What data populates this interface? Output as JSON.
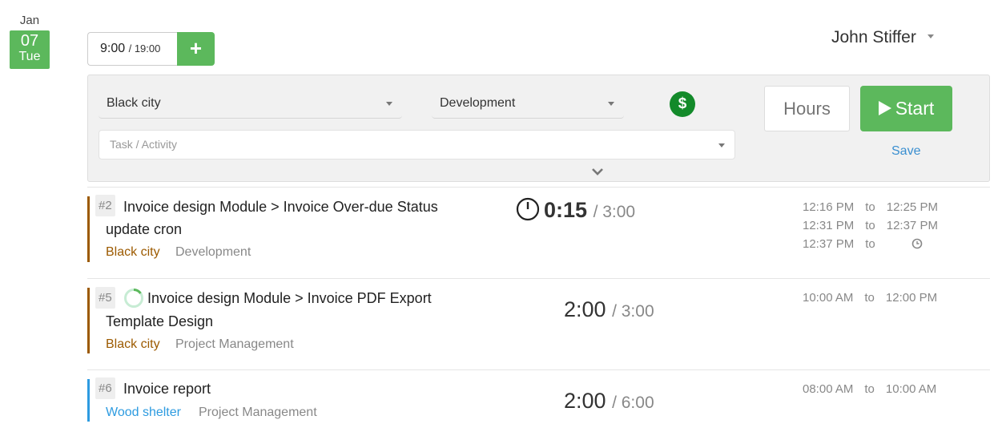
{
  "date": {
    "month": "Jan",
    "day": "07",
    "weekday": "Tue"
  },
  "summary": {
    "worked": "9:00",
    "total": "/ 19:00",
    "add_label": "+"
  },
  "user": {
    "name": "John Stiffer"
  },
  "entry_form": {
    "project": "Black city",
    "category": "Development",
    "billable_symbol": "$",
    "task_placeholder": "Task / Activity",
    "hours_placeholder": "Hours",
    "start_label": "Start",
    "save_label": "Save"
  },
  "colors": {
    "accent_green": "#5cb85c",
    "billable_green": "#138a2a",
    "project_brown": "#9c5a00",
    "project_blue": "#2d9be0",
    "link_blue": "#3a8fd0"
  },
  "entries": [
    {
      "num": "#2",
      "title_line1": "Invoice design Module > Invoice Over-due Status",
      "title_line2": "update cron",
      "project": "Black city",
      "category": "Development",
      "duration": "0:15",
      "estimate": "/ 3:00",
      "running": true,
      "times": [
        {
          "start": "12:16 PM",
          "to": "to",
          "end": "12:25 PM"
        },
        {
          "start": "12:31 PM",
          "to": "to",
          "end": "12:37 PM"
        },
        {
          "start": "12:37 PM",
          "to": "to",
          "end": ""
        }
      ]
    },
    {
      "num": "#5",
      "title_line1": "Invoice design Module > Invoice PDF Export",
      "title_line2": "Template Design",
      "project": "Black city",
      "category": "Project Management",
      "duration": "2:00",
      "estimate": "/ 3:00",
      "times": [
        {
          "start": "10:00 AM",
          "to": "to",
          "end": "12:00 PM"
        }
      ]
    },
    {
      "num": "#6",
      "title_line1": "Invoice report",
      "project": "Wood shelter",
      "category": "Project Management",
      "duration": "2:00",
      "estimate": "/ 6:00",
      "times": [
        {
          "start": "08:00 AM",
          "to": "to",
          "end": "10:00 AM"
        }
      ]
    }
  ]
}
